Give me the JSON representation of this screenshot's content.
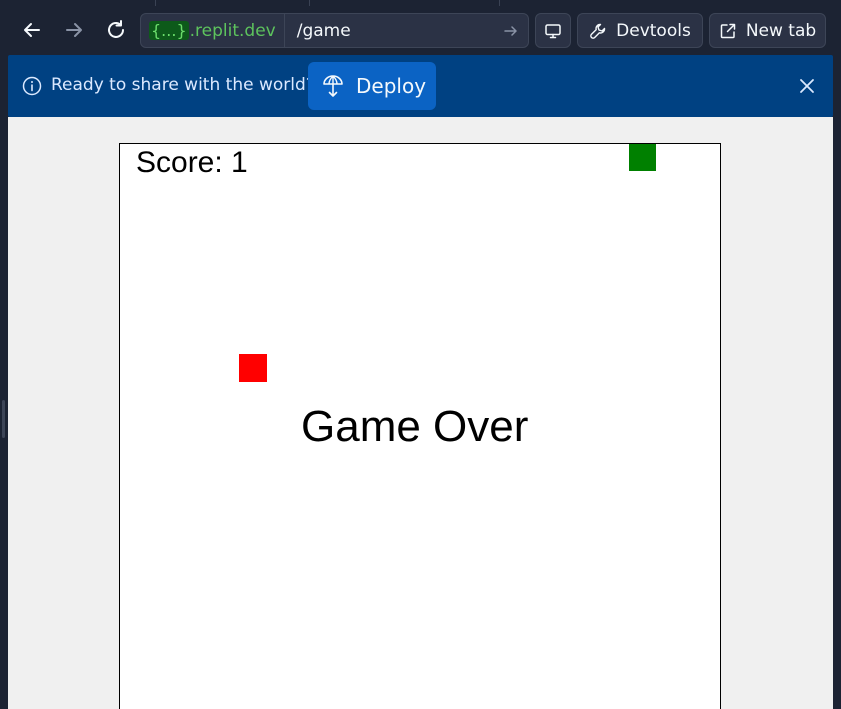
{
  "browser": {
    "url_prefix_badge": "{...}",
    "url_domain": ".replit.dev",
    "url_path": "/game",
    "devtools_label": "Devtools",
    "newtab_label": "New tab"
  },
  "banner": {
    "message": "Ready to share with the world?",
    "deploy_label": "Deploy"
  },
  "game": {
    "score_text": "Score: 1",
    "status_text": "Game Over",
    "snake_color": "#008000",
    "food_color": "#ff0000"
  },
  "icons": {
    "back": "arrow-left-icon",
    "forward": "arrow-right-icon",
    "reload": "reload-icon",
    "go": "arrow-right-icon",
    "screen": "monitor-icon",
    "devtools": "wrench-icon",
    "newtab": "external-link-icon",
    "info": "info-icon",
    "deploy": "deploy-icon",
    "close": "close-icon"
  }
}
